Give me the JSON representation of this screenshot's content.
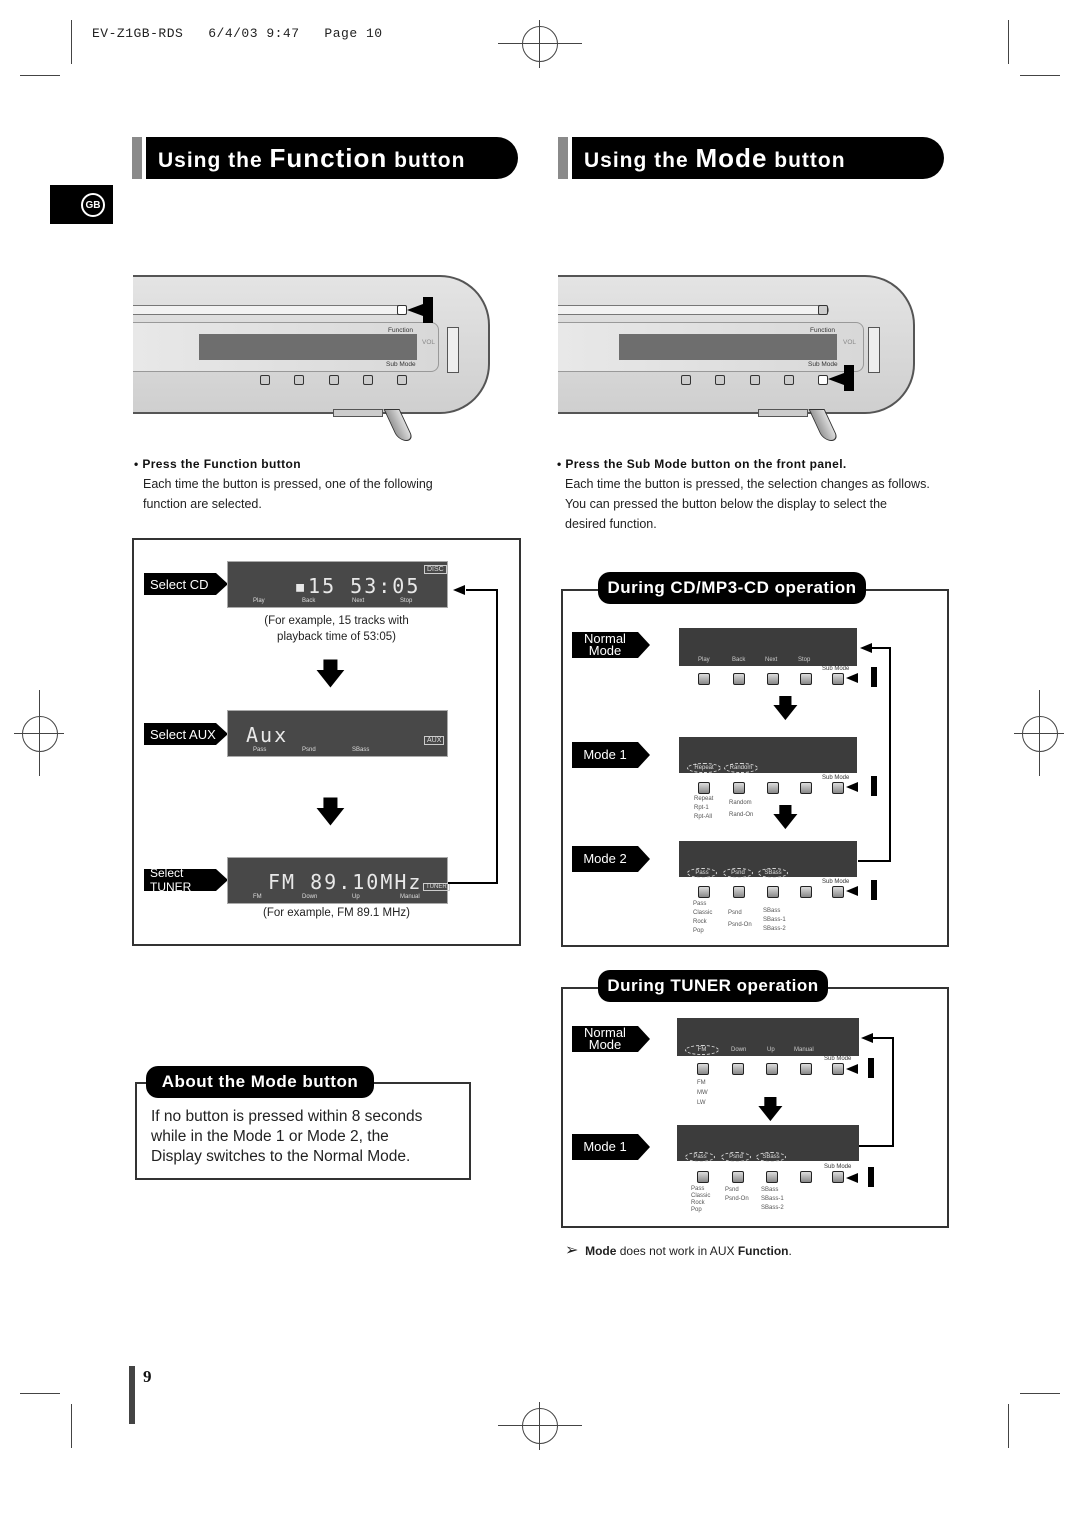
{
  "slug": "EV-Z1GB-RDS   6/4/03 9:47   Page 10",
  "language_badge": "GB",
  "headers": {
    "function": {
      "pre": "Using the ",
      "big": "Function",
      "post": " button"
    },
    "mode": {
      "pre": "Using the ",
      "big": "Mode",
      "post": " button"
    }
  },
  "device": {
    "function_label": "Function",
    "submode_label": "Sub Mode",
    "vol_label": "VOL"
  },
  "function_section": {
    "bullet": "• Press the Function button",
    "text": [
      "Each time the button is pressed, one of the following",
      "function are selected."
    ],
    "items": [
      {
        "tag": "Select CD",
        "display": "▪15  53:05",
        "badge": "DISC",
        "labels": [
          "Play",
          "Back",
          "Next",
          "Stop"
        ],
        "caption": [
          "(For example, 15 tracks with",
          "playback time of 53:05)"
        ]
      },
      {
        "tag": "Select AUX",
        "display": "Aux",
        "badge": "AUX",
        "labels": [
          "Pass",
          "Psnd",
          "SBass"
        ],
        "caption": []
      },
      {
        "tag": "Select TUNER",
        "display": "FM  89.10MHz",
        "badge": "TUNER",
        "labels": [
          "FM",
          "Down",
          "Up",
          "Manual"
        ],
        "caption": [
          "(For example, FM 89.1 MHz)"
        ]
      }
    ]
  },
  "mode_section": {
    "bullet": "• Press the Sub Mode button on the front panel.",
    "text": [
      "Each time the button is pressed, the selection changes as follows.",
      "You can pressed the button below the display to select the",
      "desired function."
    ],
    "cd": {
      "title": "During CD/MP3-CD operation",
      "normal": {
        "tag": [
          "Normal",
          "Mode"
        ],
        "labels": [
          "Play",
          "Back",
          "Next",
          "Stop"
        ]
      },
      "mode1": {
        "tag": "Mode 1",
        "ovals": [
          "Repeat",
          "Random"
        ],
        "options": [
          [
            "Repeat",
            "Rpt-1",
            "Rpt-All"
          ],
          [
            "Random",
            "Rand-On"
          ]
        ]
      },
      "mode2": {
        "tag": "Mode 2",
        "ovals": [
          "Pass",
          "Psnd",
          "SBass"
        ],
        "options": [
          [
            "Pass",
            "Classic",
            "Rock",
            "Pop"
          ],
          [
            "Psnd",
            "Psnd-On"
          ],
          [
            "SBass",
            "SBass-1",
            "SBass-2"
          ]
        ]
      },
      "submode": "Sub Mode"
    },
    "tuner": {
      "title": "During TUNER operation",
      "normal": {
        "tag": [
          "Normal",
          "Mode"
        ],
        "labels": [
          "FM",
          "Down",
          "Up",
          "Manual"
        ],
        "options": [
          "FM",
          "MW",
          "LW"
        ]
      },
      "mode1": {
        "tag": "Mode 1",
        "ovals": [
          "Pass",
          "Psnd",
          "SBass"
        ],
        "options": [
          [
            "Pass",
            "Classic",
            "Rock",
            "Pop"
          ],
          [
            "Psnd",
            "Psnd-On"
          ],
          [
            "SBass",
            "SBass-1",
            "SBass-2"
          ]
        ]
      },
      "submode": "Sub Mode"
    },
    "note": {
      "b1": "Mode",
      "t1": " does not work in AUX ",
      "b2": "Function",
      "t2": "."
    }
  },
  "about": {
    "title": "About the Mode button",
    "text": [
      "If no button is pressed within 8 seconds",
      "while in the Mode 1 or Mode 2, the",
      "Display switches to the Normal Mode."
    ]
  },
  "page_number": "9"
}
